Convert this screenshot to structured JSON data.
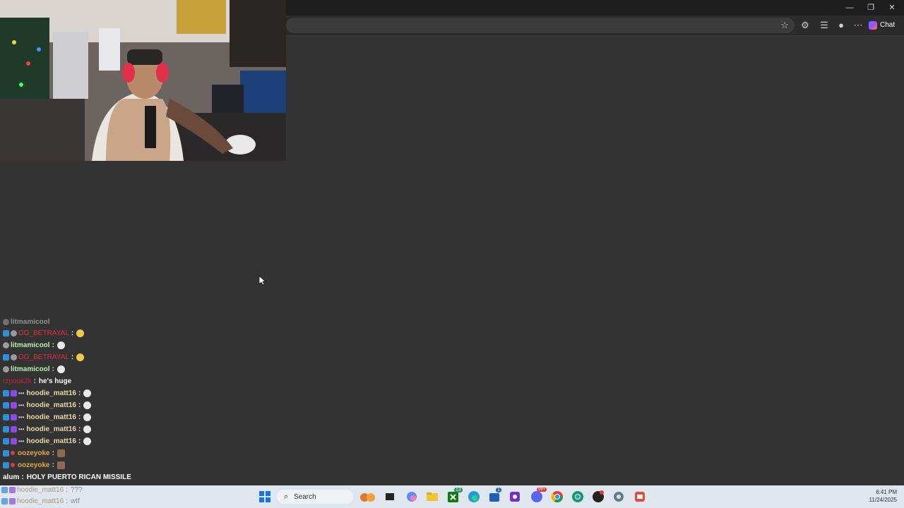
{
  "browser": {
    "window_controls": [
      "—",
      "❐",
      "✕"
    ],
    "chat_label": "Chat"
  },
  "chat_overlay": {
    "messages": [
      {
        "user": "litmamicool",
        "text": ""
      },
      {
        "user": "OG_BETRAYAL",
        "text": "",
        "color": "#e0303a"
      },
      {
        "user": "litmamicool",
        "text": "",
        "color": "#ffffff"
      },
      {
        "user": "litmamicool",
        "text": "",
        "color": "#ffffff"
      },
      {
        "user": "OG_BETRAYAL",
        "text": "",
        "color": "#e0303a"
      },
      {
        "user": "litmamicool",
        "text": "",
        "color": "#ffffff"
      },
      {
        "user": "rzpouk2k",
        "text": "he's huge",
        "color": "#c0203a"
      },
      {
        "user": "hoodie_matt16",
        "text": "",
        "color": "#e8d9a8"
      },
      {
        "user": "hoodie_matt16",
        "text": "",
        "color": "#e8d9a8"
      },
      {
        "user": "hoodie_matt16",
        "text": "",
        "color": "#e8d9a8"
      },
      {
        "user": "hoodie_matt16",
        "text": "",
        "color": "#e8d9a8"
      },
      {
        "user": "hoodie_matt16",
        "text": "",
        "color": "#e8d9a8"
      },
      {
        "user": "oozeyoke",
        "text": "",
        "color": "#e0a84a"
      },
      {
        "user": "oozeyoke",
        "text": "",
        "color": "#e0a84a"
      },
      {
        "user": "alum",
        "text": "HOLY PUERTO RICAN MISSILE",
        "color": "#ffffff"
      },
      {
        "user": "hoodie_matt16",
        "text": "???",
        "color": "#e8d9a8"
      },
      {
        "user": "hoodie_matt16",
        "text": "wtf",
        "color": "#e8d9a8"
      }
    ]
  },
  "taskbar": {
    "search_placeholder": "Search",
    "badges": {
      "xbox": "13",
      "store": "1",
      "discord": "99+"
    },
    "time": "6:41 PM",
    "date": "11/24/2025"
  }
}
